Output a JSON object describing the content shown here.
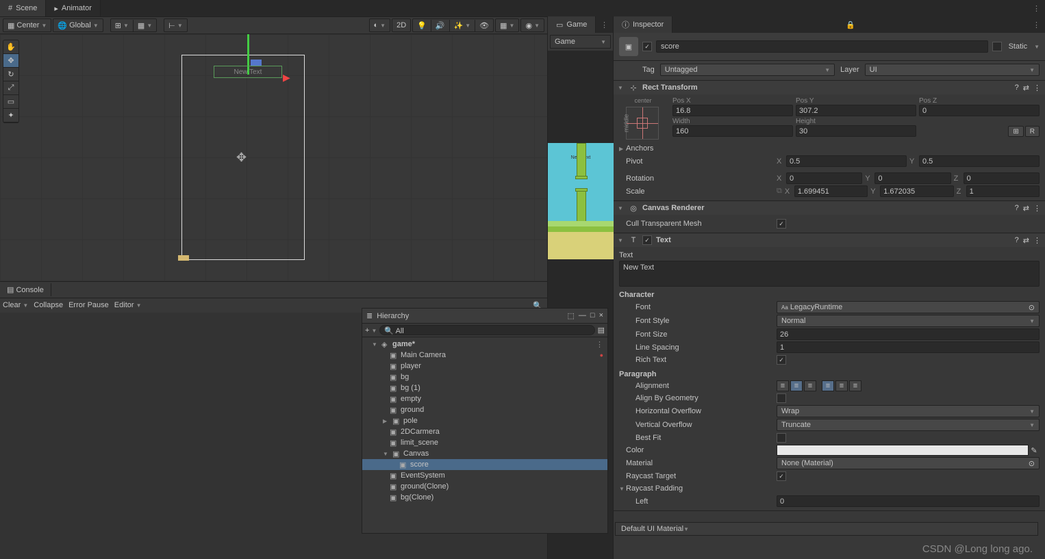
{
  "tabs": {
    "scene": "Scene",
    "animator": "Animator"
  },
  "toolbar": {
    "center": "Center",
    "global": "Global",
    "mode2d": "2D"
  },
  "console": {
    "title": "Console",
    "clear": "Clear",
    "collapse": "Collapse",
    "errorPause": "Error Pause",
    "editor": "Editor"
  },
  "game": {
    "tab": "Game",
    "dropdown": "Game",
    "previewText": "New Text"
  },
  "inspector": {
    "title": "Inspector",
    "objName": "score",
    "static": "Static",
    "tagLabel": "Tag",
    "tag": "Untagged",
    "layerLabel": "Layer",
    "layer": "UI"
  },
  "rectTransform": {
    "title": "Rect Transform",
    "anchorMode": "center",
    "posX": {
      "label": "Pos X",
      "value": "16.8"
    },
    "posY": {
      "label": "Pos Y",
      "value": "307.2"
    },
    "posZ": {
      "label": "Pos Z",
      "value": "0"
    },
    "width": {
      "label": "Width",
      "value": "160"
    },
    "height": {
      "label": "Height",
      "value": "30"
    },
    "anchors": "Anchors",
    "pivot": {
      "label": "Pivot",
      "x": "0.5",
      "y": "0.5"
    },
    "rotation": {
      "label": "Rotation",
      "x": "0",
      "y": "0",
      "z": "0"
    },
    "scale": {
      "label": "Scale",
      "x": "1.699451",
      "y": "1.672035",
      "z": "1"
    },
    "btnBlueprint": "⊞",
    "btnRaw": "R"
  },
  "canvasRenderer": {
    "title": "Canvas Renderer",
    "cullLabel": "Cull Transparent Mesh"
  },
  "textComp": {
    "title": "Text",
    "textLabel": "Text",
    "textValue": "New Text",
    "characterHeader": "Character",
    "font": {
      "label": "Font",
      "value": "LegacyRuntime"
    },
    "fontStyle": {
      "label": "Font Style",
      "value": "Normal"
    },
    "fontSize": {
      "label": "Font Size",
      "value": "26"
    },
    "lineSpacing": {
      "label": "Line Spacing",
      "value": "1"
    },
    "richText": "Rich Text",
    "paragraphHeader": "Paragraph",
    "alignment": "Alignment",
    "alignByGeom": "Align By Geometry",
    "hOverflow": {
      "label": "Horizontal Overflow",
      "value": "Wrap"
    },
    "vOverflow": {
      "label": "Vertical Overflow",
      "value": "Truncate"
    },
    "bestFit": "Best Fit",
    "color": "Color",
    "material": {
      "label": "Material",
      "value": "None (Material)"
    },
    "raycastTarget": "Raycast Target",
    "raycastPadding": "Raycast Padding",
    "left": {
      "label": "Left",
      "value": "0"
    }
  },
  "defaultMaterial": "Default UI Material",
  "hierarchy": {
    "title": "Hierarchy",
    "searchPlaceholder": "All",
    "scene": "game*",
    "items": [
      "Main Camera",
      "player",
      "bg",
      "bg (1)",
      "empty",
      "ground",
      "pole",
      "2DCarmera",
      "limit_scene",
      "Canvas",
      "score",
      "EventSystem",
      "ground(Clone)",
      "bg(Clone)"
    ]
  },
  "sceneText": "New Text",
  "watermark": "CSDN @Long long ago."
}
